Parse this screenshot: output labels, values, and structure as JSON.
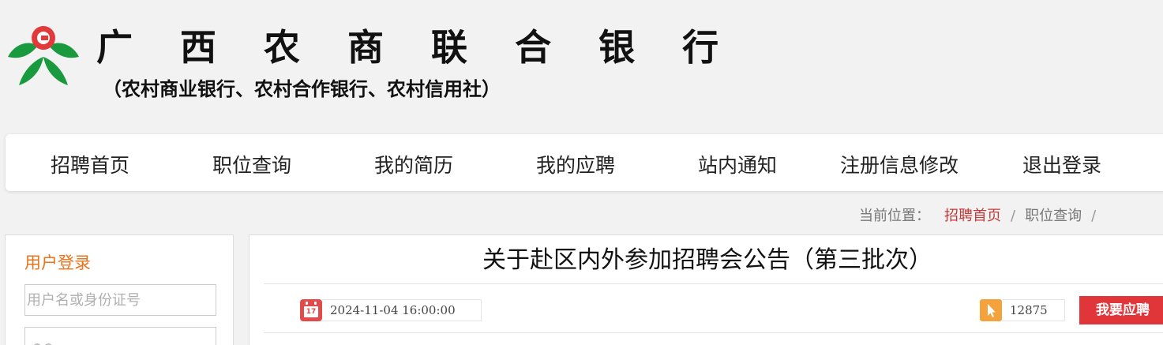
{
  "header": {
    "title": "广 西 农 商 联 合 银 行",
    "subtitle": "（农村商业银行、农村合作银行、农村信用社）",
    "logo_icon": "bank-logo-icon",
    "brand_color": "#1a9a3e"
  },
  "nav": {
    "items": [
      {
        "label": "招聘首页"
      },
      {
        "label": "职位查询"
      },
      {
        "label": "我的简历"
      },
      {
        "label": "我的应聘"
      },
      {
        "label": "站内通知"
      },
      {
        "label": "注册信息修改"
      },
      {
        "label": "退出登录"
      }
    ]
  },
  "breadcrumb": {
    "prefix": "当前位置：",
    "items": [
      "招聘首页",
      "职位查询"
    ],
    "separator": "/"
  },
  "login": {
    "title": "用户登录",
    "username_placeholder": "用户名或身份证号",
    "password_placeholder": "",
    "accent_color": "#e8731a"
  },
  "article": {
    "title": "关于赴区内外参加招聘会公告（第三批次）",
    "date": "2024-11-04 16:00:00",
    "date_icon": "calendar-icon",
    "calendar_day": "17",
    "views": "12875",
    "views_icon": "cursor-icon",
    "apply_label": "我要应聘",
    "apply_color": "#e0363a"
  }
}
